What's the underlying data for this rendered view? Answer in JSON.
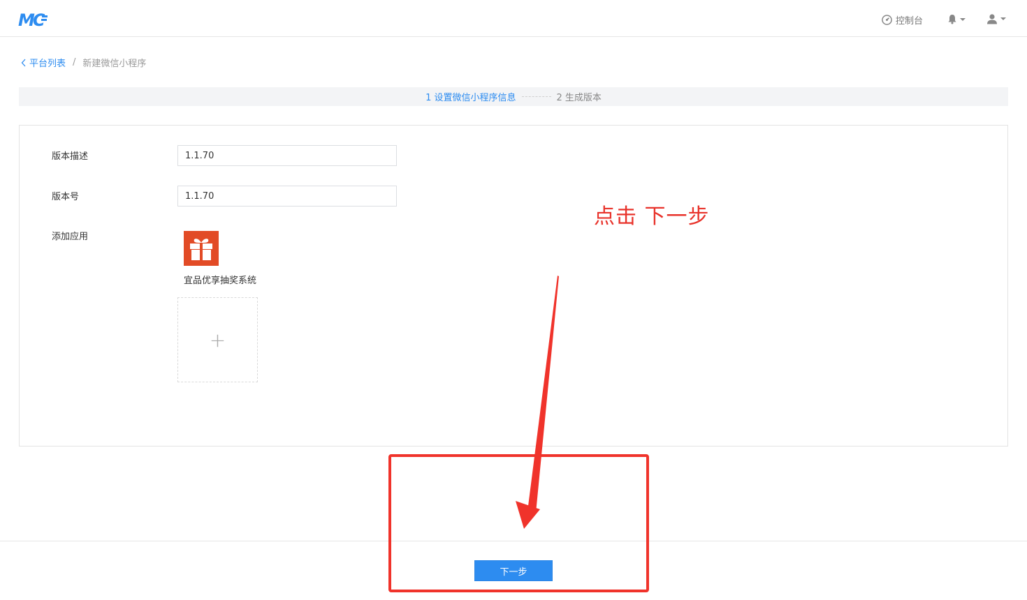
{
  "header": {
    "logo_text": "MC",
    "console_label": "控制台"
  },
  "breadcrumb": {
    "back_label": "平台列表",
    "separator": "/",
    "current": "新建微信小程序"
  },
  "steps": [
    {
      "label": "1 设置微信小程序信息",
      "state": "active"
    },
    {
      "label": "2 生成版本",
      "state": "inactive"
    }
  ],
  "form": {
    "version_desc": {
      "label": "版本描述",
      "value": "1.1.70"
    },
    "version_no": {
      "label": "版本号",
      "value": "1.1.70"
    },
    "add_app": {
      "label": "添加应用",
      "apps": [
        {
          "name": "宜品优享抽奖系统",
          "icon": "gift-icon",
          "icon_color": "#e24b26"
        }
      ],
      "add_symbol": "+"
    }
  },
  "footer": {
    "next_label": "下一步"
  },
  "annotation": {
    "text": "点击 下一步",
    "color": "#e8322a"
  },
  "colors": {
    "primary": "#2d8cf0"
  }
}
